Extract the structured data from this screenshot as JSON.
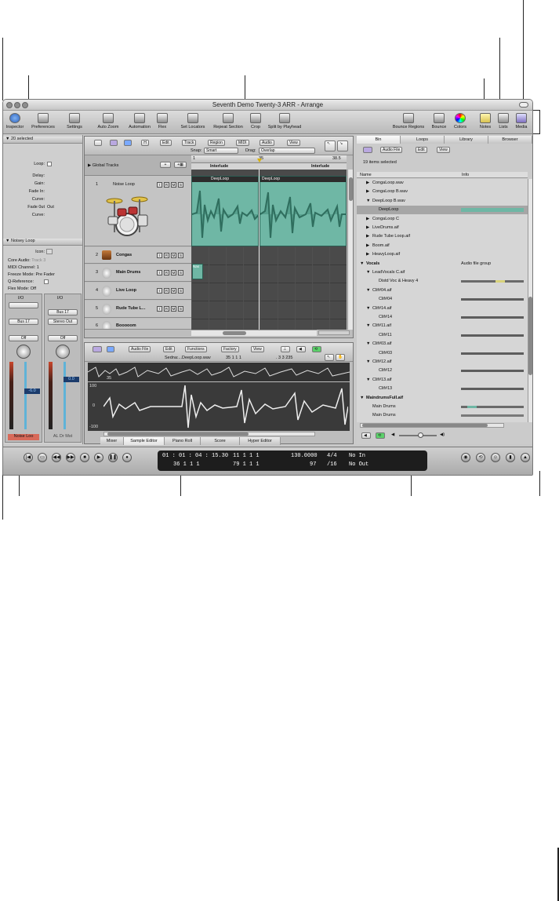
{
  "window": {
    "title": "Seventh Demo Twenty-3 ARR - Arrange"
  },
  "toolbar": {
    "left": [
      "Inspector",
      "Preferences",
      "Settings",
      "Auto Zoom",
      "Automation",
      "Flex",
      "Set Locators",
      "Repeat Section",
      "Crop",
      "Split by Playhead"
    ],
    "right": [
      "Bounce Regions",
      "Bounce",
      "Colors",
      "Notes",
      "Lists",
      "Media"
    ]
  },
  "inspector": {
    "region_header": "20 selected",
    "region_params": [
      "Loop:",
      "Delay:",
      "Gain:",
      "Fade In:",
      "Curve:",
      "Fade 0ut",
      "Curve:"
    ],
    "fade_type": "Out",
    "track_header": "Noisey Loop",
    "track_params": [
      {
        "label": "Icon:",
        "value": ""
      },
      {
        "label": "Core Audio:",
        "value": "Track 3"
      },
      {
        "label": "MIDI Channel:",
        "value": "1"
      },
      {
        "label": "Freeze Mode:",
        "value": "Pre Fader"
      },
      {
        "label": "Q-Reference:",
        "value": ""
      },
      {
        "label": "Flex Mode:",
        "value": "Off"
      }
    ],
    "strip1": {
      "io": "I/O",
      "bus": "Bus 17",
      "off": "Off",
      "volume": "-6.0",
      "name": "Noise Loo"
    },
    "strip2": {
      "io": "I/O",
      "bus1": "Bus 17",
      "bus2": "Stereo Out",
      "off": "Off",
      "volume": "0.0",
      "name": "AL Dr Mst"
    }
  },
  "arrange": {
    "menu": [
      "Edit",
      "Track",
      "Region",
      "MIDI",
      "Audio",
      "View"
    ],
    "snap_label": "Snap:",
    "snap_value": "Smart",
    "drag_label": "Drag:",
    "drag_value": "Overlap",
    "global_tracks": "Global Tracks",
    "ruler": [
      "1",
      "35",
      "38.5"
    ],
    "markers": [
      "Interlude",
      "Interlude"
    ],
    "regions": [
      "DeepLoop",
      "DeepLoop"
    ],
    "tracks": [
      {
        "num": "1",
        "name": "Noise Loop"
      },
      {
        "num": "2",
        "name": "Congas"
      },
      {
        "num": "3",
        "name": "Main Drums"
      },
      {
        "num": "4",
        "name": "Live Loop"
      },
      {
        "num": "5",
        "name": "Rude Tube L..."
      },
      {
        "num": "6",
        "name": "Booooom"
      }
    ],
    "small_region": "Nas"
  },
  "editor": {
    "menu": [
      "Audio File",
      "Edit",
      "Functions",
      "Factory",
      "View"
    ],
    "file": "Sedna:...DeepLoop.wav",
    "pos1": "35  1  1  1",
    "pos2": ".  3  3  235",
    "ruler": "35",
    "scale": [
      "100",
      "0",
      "-100"
    ],
    "tabs": [
      "Mixer",
      "Sample Editor",
      "Piano Roll",
      "Score",
      "Hyper Editor"
    ],
    "active_tab": "Sample Editor"
  },
  "media": {
    "tabs": [
      "Bin",
      "Loops",
      "Library",
      "Browser"
    ],
    "menu": [
      "Audio File",
      "Edit",
      "View"
    ],
    "status": "19 items selected",
    "columns": [
      "Name",
      "Info"
    ],
    "rows": [
      {
        "name": "CongaLoop.wav",
        "indent": 1,
        "arrow": "▶",
        "bar": ""
      },
      {
        "name": "CongaLoop B.wav",
        "indent": 1,
        "arrow": "▶",
        "bar": ""
      },
      {
        "name": "DeepLoop B.wav",
        "indent": 1,
        "arrow": "▼",
        "bar": ""
      },
      {
        "name": "DeepLoop",
        "indent": 2,
        "arrow": "",
        "bar": "teal",
        "sel": true
      },
      {
        "name": "CongaLoop C",
        "indent": 1,
        "arrow": "▶",
        "bar": ""
      },
      {
        "name": "LiveDrums.aif",
        "indent": 1,
        "arrow": "▶",
        "bar": ""
      },
      {
        "name": "Rude Tube Loop.aif",
        "indent": 1,
        "arrow": "▶",
        "bar": ""
      },
      {
        "name": "Boom.aif",
        "indent": 1,
        "arrow": "▶",
        "bar": ""
      },
      {
        "name": "HeavyLoop.aif",
        "indent": 1,
        "arrow": "▶",
        "bar": ""
      },
      {
        "name": "Vocals",
        "indent": 0,
        "arrow": "▼",
        "bar": "",
        "info": "Audio file group"
      },
      {
        "name": "LeadVocals C.aif",
        "indent": 1,
        "arrow": "▼",
        "bar": ""
      },
      {
        "name": "Distd Voc & Heavy 4",
        "indent": 2,
        "arrow": "",
        "bar": "grey-hl"
      },
      {
        "name": "Clif#04.aif",
        "indent": 1,
        "arrow": "▼",
        "bar": ""
      },
      {
        "name": "Clif#04",
        "indent": 2,
        "arrow": "",
        "bar": "grey"
      },
      {
        "name": "Clif#14.aif",
        "indent": 1,
        "arrow": "▼",
        "bar": ""
      },
      {
        "name": "Clif#14",
        "indent": 2,
        "arrow": "",
        "bar": "grey"
      },
      {
        "name": "Clif#11.aif",
        "indent": 1,
        "arrow": "▼",
        "bar": ""
      },
      {
        "name": "Clif#11",
        "indent": 2,
        "arrow": "",
        "bar": "grey"
      },
      {
        "name": "Clif#03.aif",
        "indent": 1,
        "arrow": "▼",
        "bar": ""
      },
      {
        "name": "Clif#03",
        "indent": 2,
        "arrow": "",
        "bar": "grey"
      },
      {
        "name": "Clif#12.aif",
        "indent": 1,
        "arrow": "▼",
        "bar": ""
      },
      {
        "name": "Clif#12",
        "indent": 2,
        "arrow": "",
        "bar": "grey"
      },
      {
        "name": "Clif#13.aif",
        "indent": 1,
        "arrow": "▼",
        "bar": ""
      },
      {
        "name": "Clif#13",
        "indent": 2,
        "arrow": "",
        "bar": "grey"
      },
      {
        "name": "MaindrumsFull.aif",
        "indent": 0,
        "arrow": "▼",
        "bar": ""
      },
      {
        "name": "Main Drums",
        "indent": 1,
        "arrow": "",
        "bar": "teal-sm"
      },
      {
        "name": "Main Drums",
        "indent": 1,
        "arrow": "",
        "bar": "grey-sm"
      }
    ]
  },
  "transport": {
    "smpte": "01 : 01 : 04 : 15.30",
    "bars": "36   1   1   1",
    "pos_right": "11   1   1   1",
    "pos_right2": "79   1   1   1",
    "tempo": "130.0000",
    "tempo2": "97",
    "sig": "4/4",
    "sig2": "/16",
    "in": "No In",
    "out": "No Out"
  },
  "colors": {
    "region": "#6fb7a5",
    "waveform": "#2f6e5e",
    "accent": "#3b7bd0"
  }
}
